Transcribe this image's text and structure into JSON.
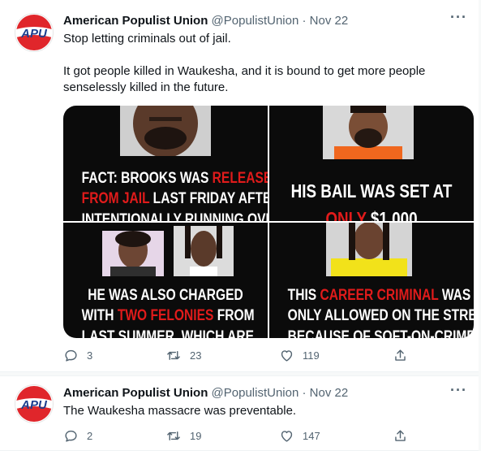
{
  "tweets": [
    {
      "avatar_text": "APU",
      "display_name": "American Populist Union",
      "handle": "@PopulistUnion",
      "dot": "·",
      "date": "Nov 22",
      "more": "···",
      "paragraphs": [
        "Stop letting criminals out of jail.",
        "It got people killed in Waukesha, and it is bound to get more people senselessly killed in the future."
      ],
      "media": [
        {
          "lines": [
            [
              "FACT: BROOKS WAS ",
              "RELEASED"
            ],
            [
              "FROM JAIL",
              " LAST FRIDAY AFTER"
            ],
            [
              "INTENTIONALLY RUNNING OVER",
              ""
            ]
          ]
        },
        {
          "lines": [
            [
              "HIS BAIL WAS SET AT",
              ""
            ],
            [
              "ONLY",
              " $1,000"
            ]
          ]
        },
        {
          "lines": [
            [
              "HE WAS ALSO CHARGED",
              ""
            ],
            [
              "WITH ",
              "TWO FELONIES",
              " FROM"
            ],
            [
              "LAST SUMMER, WHICH ARE",
              ""
            ]
          ]
        },
        {
          "lines": [
            [
              "THIS ",
              "CAREER CRIMINAL",
              " WAS"
            ],
            [
              "ONLY ALLOWED ON THE STREETS",
              ""
            ],
            [
              "BECAUSE OF SOFT-ON-CRIME",
              ""
            ]
          ]
        }
      ],
      "replies": "3",
      "retweets": "23",
      "likes": "119"
    },
    {
      "avatar_text": "APU",
      "display_name": "American Populist Union",
      "handle": "@PopulistUnion",
      "dot": "·",
      "date": "Nov 22",
      "more": "···",
      "paragraphs": [
        "The Waukesha massacre was preventable."
      ],
      "replies": "2",
      "retweets": "19",
      "likes": "147"
    }
  ],
  "icons": {
    "reply": "speech-bubble-icon",
    "retweet": "retweet-arrows-icon",
    "like": "heart-icon",
    "share": "share-upload-icon",
    "more": "more-options-icon"
  },
  "colors": {
    "logo_red": "#e0262b",
    "logo_blue": "#1d3f8f",
    "caption_red": "#e01b1b",
    "muted_text": "#536471"
  }
}
